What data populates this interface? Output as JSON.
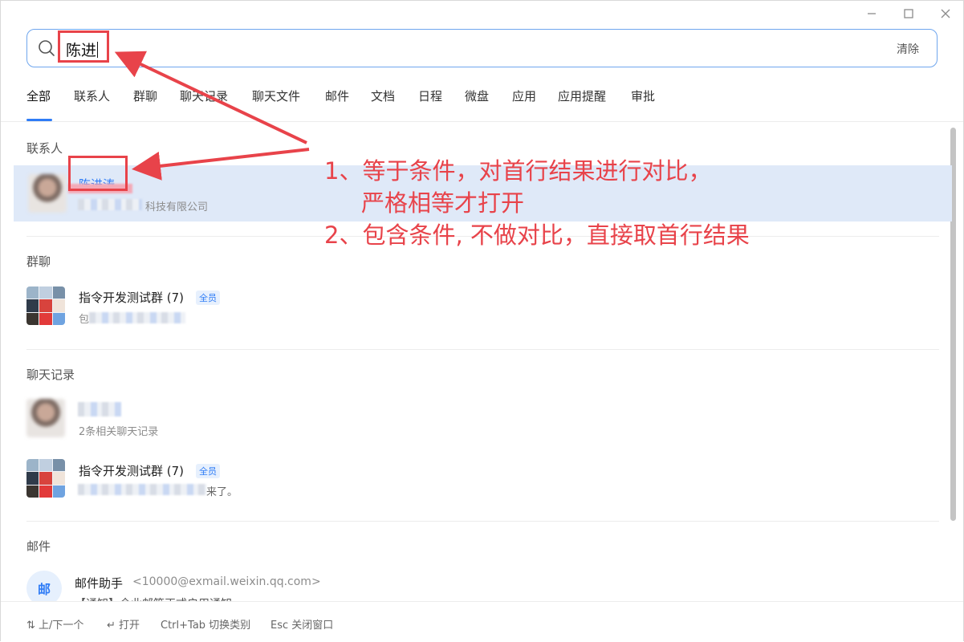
{
  "window": {
    "controls": [
      "minimize-icon",
      "maximize-icon",
      "close-icon"
    ]
  },
  "search": {
    "query": "陈进",
    "clear_label": "清除",
    "icon": "search-icon"
  },
  "tabs": [
    "全部",
    "联系人",
    "群聊",
    "聊天记录",
    "聊天文件",
    "邮件",
    "文档",
    "日程",
    "微盘",
    "应用",
    "应用提醒",
    "审批"
  ],
  "sections": {
    "contacts": {
      "title": "联系人",
      "items": [
        {
          "name": "陈进涛",
          "company": "科技有限公司"
        }
      ]
    },
    "groups": {
      "title": "群聊",
      "items": [
        {
          "name": "指令开发测试群 (7)",
          "badge": "全员",
          "preview": "包"
        }
      ]
    },
    "chat_records": {
      "title": "聊天记录",
      "items": [
        {
          "name": "",
          "preview": "2条相关聊天记录"
        },
        {
          "name": "指令开发测试群 (7)",
          "badge": "全员",
          "preview": "来了。"
        }
      ]
    },
    "mail": {
      "title": "邮件",
      "items": [
        {
          "avatar_text": "邮",
          "sender": "邮件助手",
          "address": "<10000@exmail.weixin.qq.com>",
          "preview": "【通知】企业邮箱正式启用通知"
        }
      ]
    }
  },
  "footer": {
    "hints": [
      "⇅ 上/下一个",
      "↵ 打开",
      "Ctrl+Tab 切换类别",
      "Esc 关闭窗口"
    ]
  },
  "annotation": {
    "line1": "1、等于条件，对首行结果进行对比，",
    "line2": "严格相等才打开",
    "line3": "2、包含条件, 不做对比，直接取首行结果",
    "color": "#e8434a"
  },
  "colors": {
    "accent": "#2f7cf6",
    "highlight": "#dfe9f8",
    "annotation": "#e8434a"
  }
}
